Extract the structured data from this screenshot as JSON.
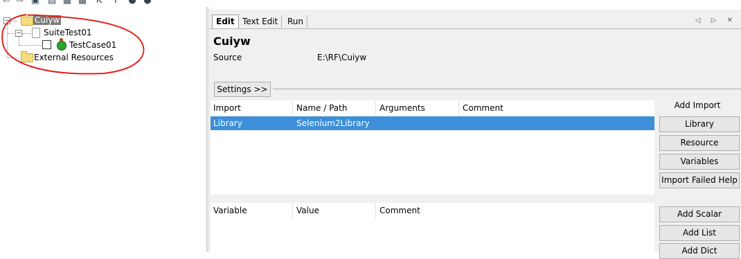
{
  "tree": {
    "root": "Cuiyw",
    "suite": "SuiteTest01",
    "testcase": "TestCase01",
    "external": "External Resources"
  },
  "tabs": [
    "Edit",
    "Text Edit",
    "Run"
  ],
  "tab_arrows": "◁ ▷ ✕",
  "editor": {
    "title": "Cuiyw",
    "source_label": "Source",
    "source_value": "E:\\RF\\Cuiyw",
    "settings_button": "Settings >>"
  },
  "import_table": {
    "headers": [
      "Import",
      "Name / Path",
      "Arguments",
      "Comment"
    ],
    "rows": [
      [
        "Library",
        "Selenium2Library",
        "",
        ""
      ]
    ]
  },
  "variable_table": {
    "headers": [
      "Variable",
      "Value",
      "Comment"
    ]
  },
  "side": {
    "add_import_label": "Add Import",
    "buttons": [
      "Library",
      "Resource",
      "Variables",
      "Import Failed Help"
    ],
    "var_buttons": [
      "Add Scalar",
      "Add List",
      "Add Dict"
    ]
  },
  "colors": {
    "selection": "#3c8fd8",
    "annotation": "#e0201c"
  }
}
